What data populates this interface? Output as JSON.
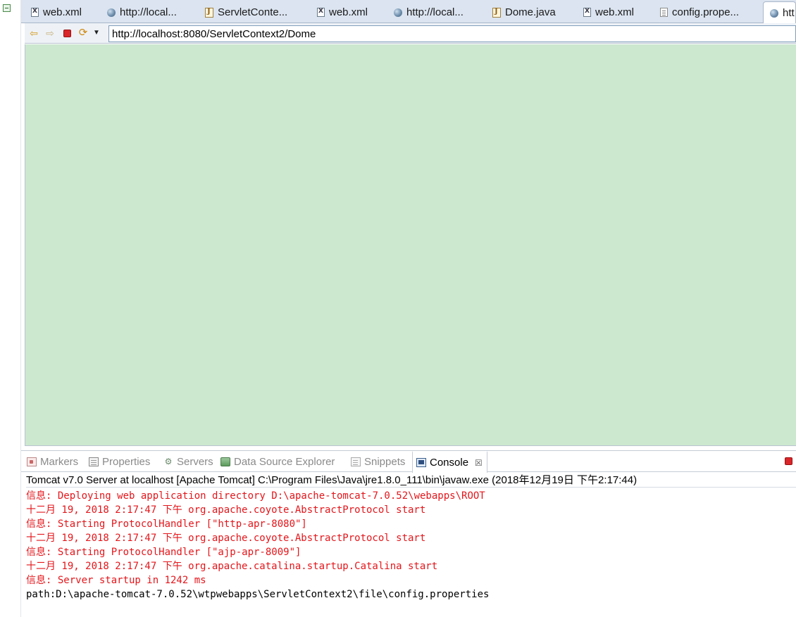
{
  "editor_tabs": [
    {
      "icon": "xml-file-icon",
      "label": "web.xml",
      "active": false
    },
    {
      "icon": "globe-icon",
      "label": "http://local...",
      "active": false
    },
    {
      "icon": "java-file-icon",
      "label": "ServletConte...",
      "active": false
    },
    {
      "icon": "xml-file-icon",
      "label": "web.xml",
      "active": false
    },
    {
      "icon": "globe-icon",
      "label": "http://local...",
      "active": false
    },
    {
      "icon": "java-file-icon",
      "label": "Dome.java",
      "active": false
    },
    {
      "icon": "xml-file-icon",
      "label": "web.xml",
      "active": false
    },
    {
      "icon": "properties-file-icon",
      "label": "config.prope...",
      "active": false
    },
    {
      "icon": "globe-icon",
      "label": "htt",
      "active": true
    }
  ],
  "browser": {
    "url": "http://localhost:8080/ServletContext2/Dome",
    "toolbar_icons": [
      "back-arrow-icon",
      "forward-arrow-icon",
      "stop-icon",
      "refresh-icon",
      "dropdown-arrow-icon"
    ],
    "content_background": "#cce8cf"
  },
  "views": [
    {
      "icon": "markers-icon",
      "label": "Markers",
      "active": false
    },
    {
      "icon": "properties-icon",
      "label": "Properties",
      "active": false
    },
    {
      "icon": "servers-icon",
      "label": "Servers",
      "active": false
    },
    {
      "icon": "data-source-explorer-icon",
      "label": "Data Source Explorer",
      "active": false
    },
    {
      "icon": "snippets-icon",
      "label": "Snippets",
      "active": false
    },
    {
      "icon": "console-icon",
      "label": "Console",
      "active": true,
      "close": "☒"
    }
  ],
  "console": {
    "header": "Tomcat v7.0 Server at localhost [Apache Tomcat] C:\\Program Files\\Java\\jre1.8.0_111\\bin\\javaw.exe (2018年12月19日 下午2:17:44)",
    "lines": [
      {
        "text": "信息: Deploying web application directory D:\\apache-tomcat-7.0.52\\webapps\\ROOT",
        "stream": "err"
      },
      {
        "text": "十二月 19, 2018 2:17:47 下午 org.apache.coyote.AbstractProtocol start",
        "stream": "err"
      },
      {
        "text": "信息: Starting ProtocolHandler [\"http-apr-8080\"]",
        "stream": "err"
      },
      {
        "text": "十二月 19, 2018 2:17:47 下午 org.apache.coyote.AbstractProtocol start",
        "stream": "err"
      },
      {
        "text": "信息: Starting ProtocolHandler [\"ajp-apr-8009\"]",
        "stream": "err"
      },
      {
        "text": "十二月 19, 2018 2:17:47 下午 org.apache.catalina.startup.Catalina start",
        "stream": "err"
      },
      {
        "text": "信息: Server startup in 1242 ms",
        "stream": "err"
      },
      {
        "text": "path:D:\\apache-tomcat-7.0.52\\wtpwebapps\\ServletContext2\\file\\config.properties",
        "stream": "out"
      }
    ]
  },
  "colors": {
    "stderr": "#e4161b",
    "stdout": "#000000",
    "tabbar": "#dbe4f0"
  }
}
